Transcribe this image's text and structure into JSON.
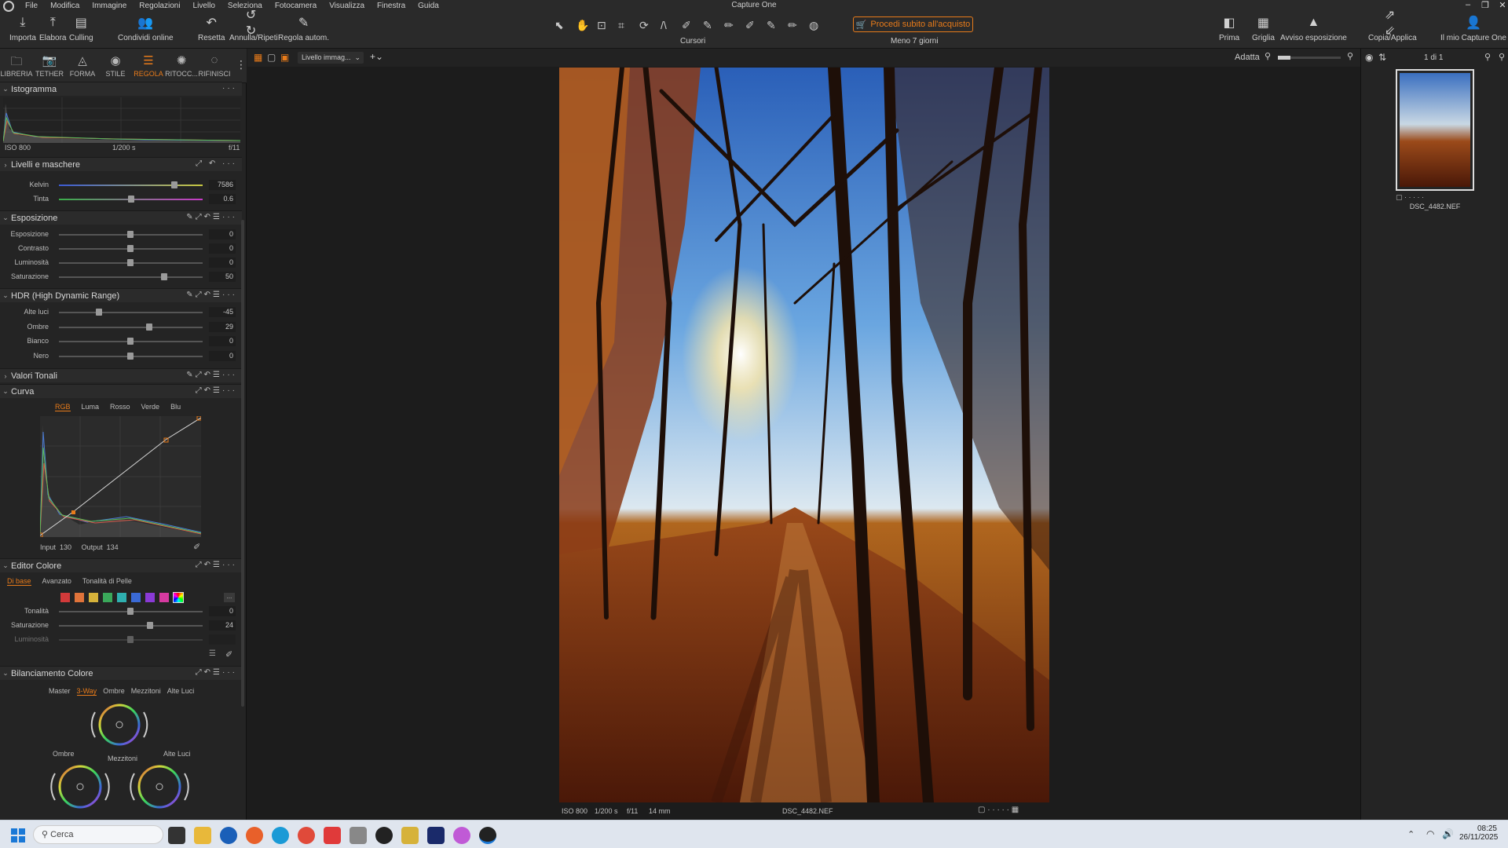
{
  "app": {
    "title": "Capture One"
  },
  "menu": [
    "File",
    "Modifica",
    "Immagine",
    "Regolazioni",
    "Livello",
    "Seleziona",
    "Fotocamera",
    "Visualizza",
    "Finestra",
    "Guida"
  ],
  "toolbar": {
    "left": [
      {
        "label": "Importa",
        "icon": "import-icon"
      },
      {
        "label": "Elabora",
        "icon": "export-icon"
      },
      {
        "label": "Culling",
        "icon": "culling-icon"
      },
      {
        "label": "Condividi online",
        "icon": "share-icon"
      },
      {
        "label": "Resetta",
        "icon": "reset-icon"
      },
      {
        "label": "Annulla/Ripeti",
        "icon": "undo-icon"
      },
      {
        "label": "Regola autom.",
        "icon": "auto-adjust-icon"
      }
    ],
    "cursors_label": "Cursori",
    "buy_label": "Procedi subito all'acquisto",
    "trial_label": "Meno 7 giorni",
    "right": [
      {
        "label": "Prima",
        "icon": "before-icon"
      },
      {
        "label": "Griglia",
        "icon": "grid-icon"
      },
      {
        "label": "Avviso esposizione",
        "icon": "warning-icon"
      },
      {
        "label": "Copia/Applica",
        "icon": "copy-apply-icon"
      },
      {
        "label": "Il mio Capture One",
        "icon": "user-icon"
      }
    ]
  },
  "tool_tabs": [
    {
      "label": "LIBRERIA",
      "active": false
    },
    {
      "label": "TETHER",
      "active": false
    },
    {
      "label": "FORMA",
      "active": false
    },
    {
      "label": "STILE",
      "active": false
    },
    {
      "label": "REGOLA",
      "active": true
    },
    {
      "label": "RITOCC...",
      "active": false
    },
    {
      "label": "RIFINISCI",
      "active": false
    }
  ],
  "histogram": {
    "title": "Istogramma",
    "iso": "ISO 800",
    "shutter": "1/200 s",
    "aperture": "f/11"
  },
  "layers": {
    "title": "Livelli e maschere"
  },
  "white_balance": [
    {
      "label": "Kelvin",
      "value": "7586",
      "pos": 0.82
    },
    {
      "label": "Tinta",
      "value": "0.6",
      "pos": 0.51
    }
  ],
  "exposure": {
    "title": "Esposizione",
    "sliders": [
      {
        "label": "Esposizione",
        "value": "0",
        "pos": 0.5
      },
      {
        "label": "Contrasto",
        "value": "0",
        "pos": 0.5
      },
      {
        "label": "Luminosità",
        "value": "0",
        "pos": 0.5
      },
      {
        "label": "Saturazione",
        "value": "50",
        "pos": 0.75
      }
    ]
  },
  "hdr": {
    "title": "HDR (High Dynamic Range)",
    "sliders": [
      {
        "label": "Alte luci",
        "value": "-45",
        "pos": 0.28
      },
      {
        "label": "Ombre",
        "value": "29",
        "pos": 0.64
      },
      {
        "label": "Bianco",
        "value": "0",
        "pos": 0.5
      },
      {
        "label": "Nero",
        "value": "0",
        "pos": 0.5
      }
    ]
  },
  "tonal": {
    "title": "Valori Tonali"
  },
  "curve": {
    "title": "Curva",
    "tabs": [
      "RGB",
      "Luma",
      "Rosso",
      "Verde",
      "Blu"
    ],
    "input_label": "Input",
    "input": "130",
    "output_label": "Output",
    "output": "134"
  },
  "color_editor": {
    "title": "Editor Colore",
    "tabs": [
      "Di base",
      "Avanzato",
      "Tonalità di Pelle"
    ],
    "swatches": [
      "#d23a3a",
      "#e0733a",
      "#d6b23a",
      "#3aa85a",
      "#2fb0b0",
      "#3a6ad6",
      "#8a3ad6",
      "#d63aa0"
    ],
    "more_label": "...",
    "sliders": [
      {
        "label": "Tonalità",
        "value": "0",
        "pos": 0.5
      },
      {
        "label": "Saturazione",
        "value": "24",
        "pos": 0.64
      },
      {
        "label": "Luminosità",
        "value": "",
        "pos": 0.5
      }
    ]
  },
  "color_balance": {
    "title": "Bilanciamento Colore",
    "tabs": [
      "Master",
      "3-Way",
      "Ombre",
      "Mezzitoni",
      "Alte Luci"
    ],
    "wheel_labels": {
      "mid": "Mezzitoni",
      "shadows": "Ombre",
      "highlights": "Alte Luci"
    }
  },
  "viewer": {
    "layer_select": "Livello immag...",
    "fit_label": "Adatta",
    "count_label": "1 di 1"
  },
  "info": {
    "iso": "ISO 800",
    "shutter": "1/200 s",
    "aperture": "f/11",
    "focal": "14 mm",
    "filename": "DSC_4482.NEF"
  },
  "thumbnail": {
    "filename": "DSC_4482.NEF"
  },
  "taskbar": {
    "search_placeholder": "Cerca",
    "time": "08:25",
    "date": "26/11/2025"
  },
  "colors": {
    "accent": "#e87b1a",
    "panel": "#242424",
    "bg": "#1c1c1c"
  }
}
